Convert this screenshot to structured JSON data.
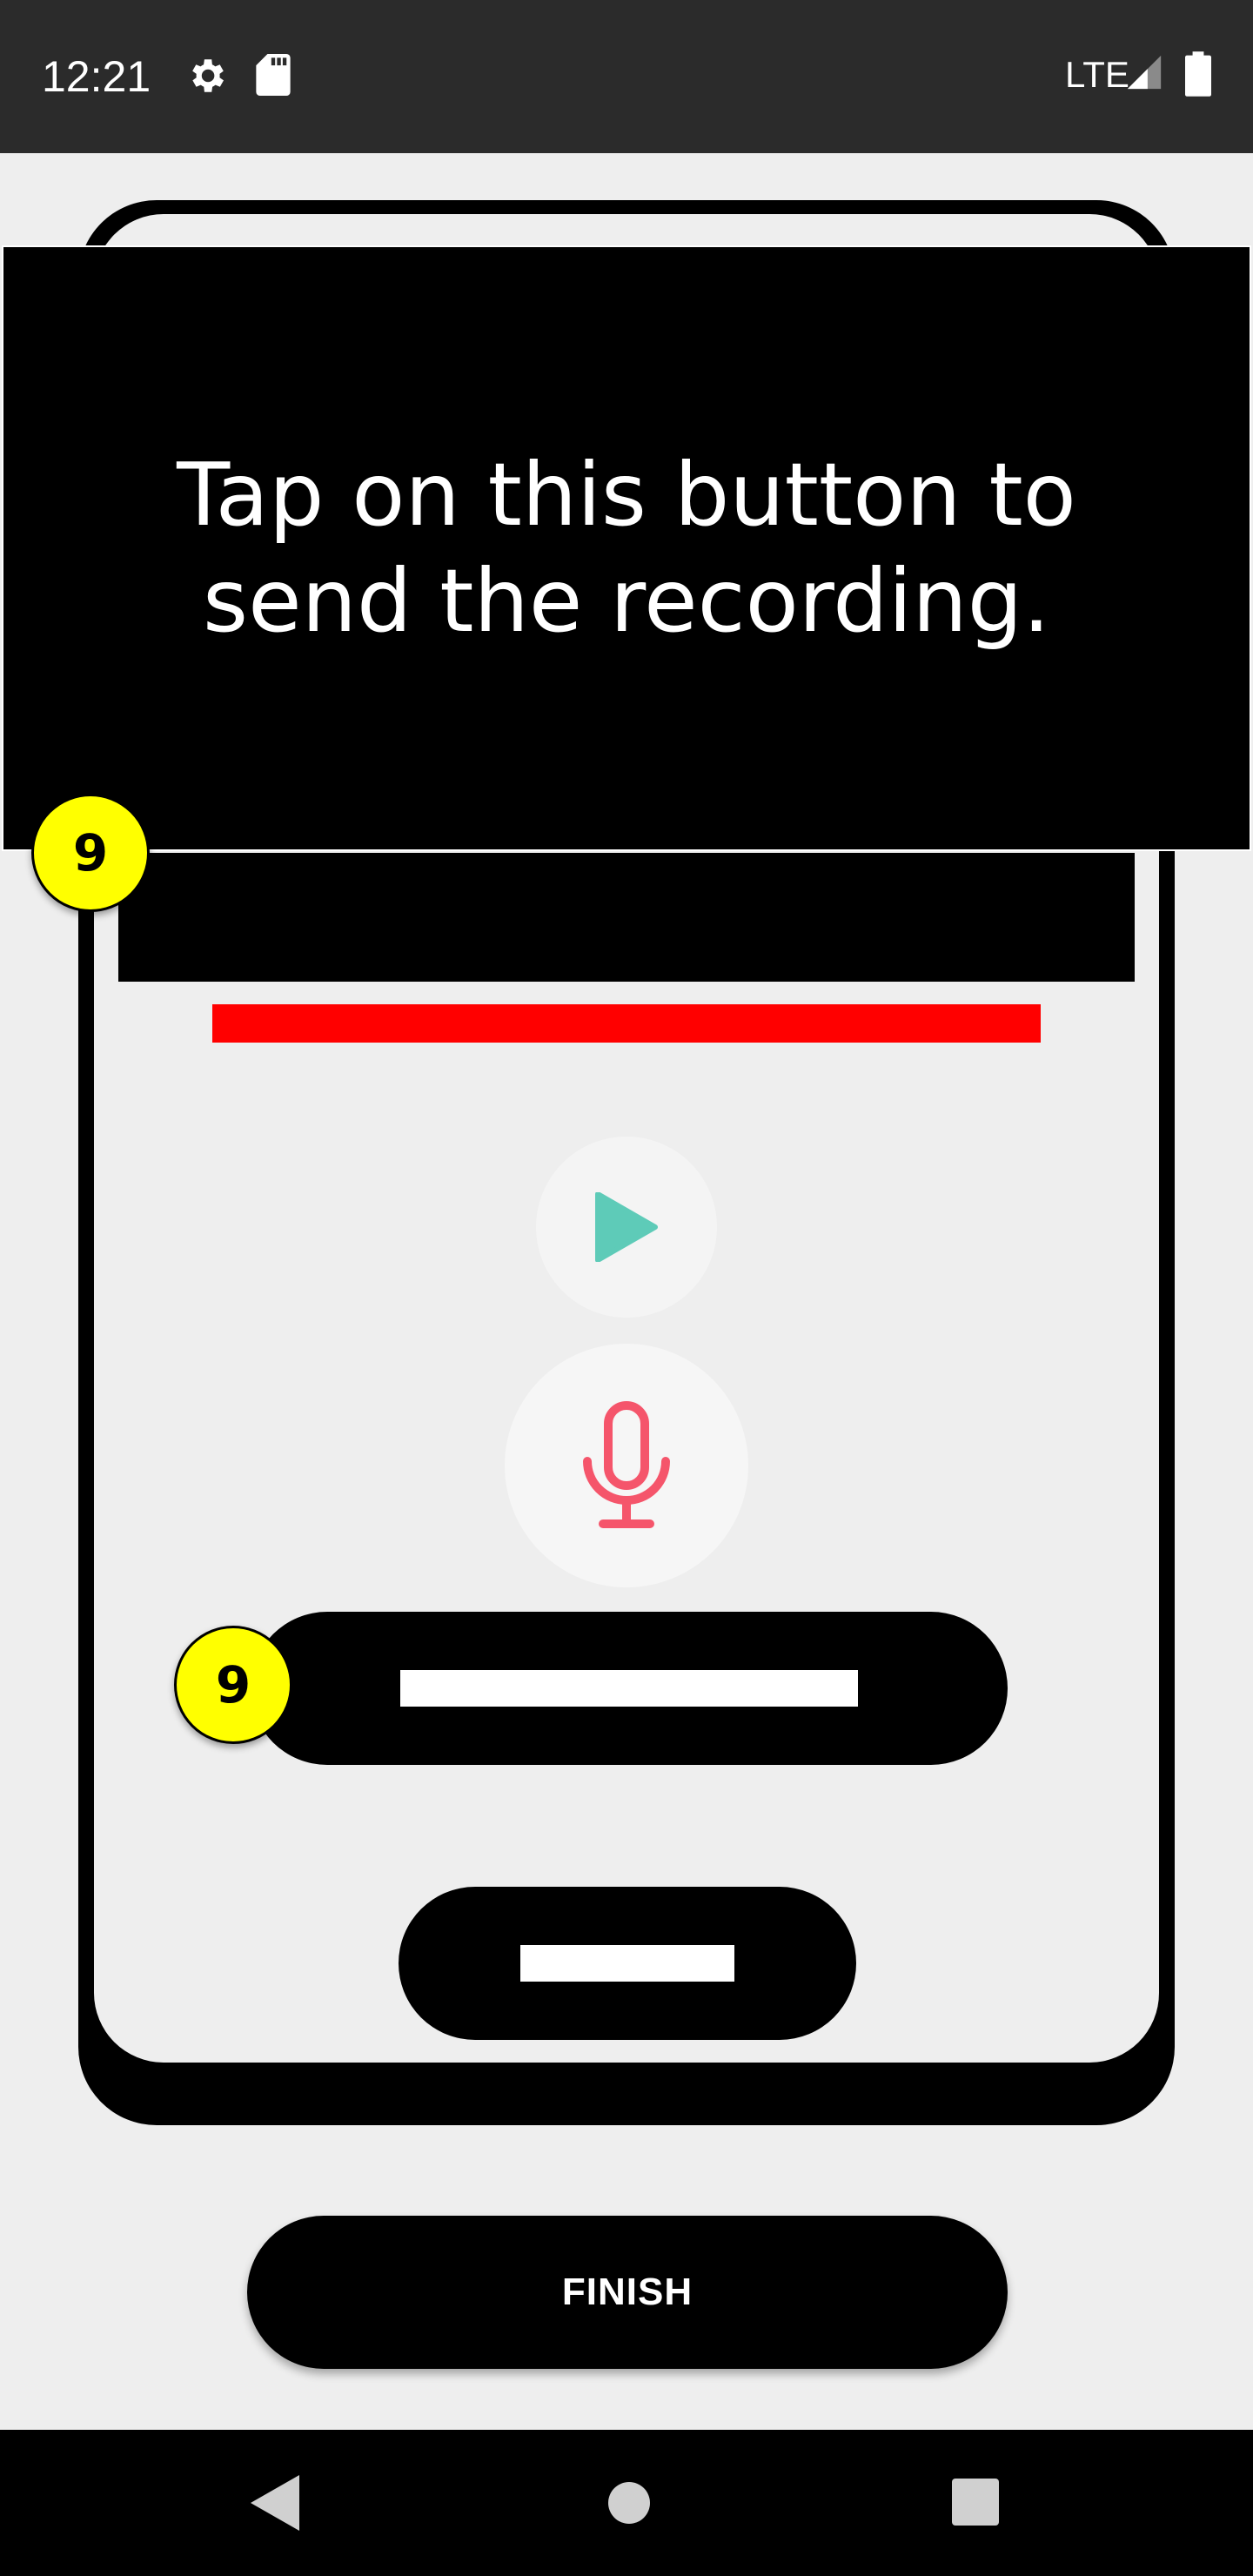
{
  "status_bar": {
    "time": "12:21",
    "network": "LTE",
    "icons": [
      "gear-icon",
      "sd-card-icon",
      "signal-icon",
      "battery-icon"
    ]
  },
  "tooltip": {
    "text": "Tap on this button to send the recording."
  },
  "badges": {
    "top": "9",
    "send": "9"
  },
  "controls": {
    "play_icon": "play-icon",
    "mic_icon": "microphone-icon"
  },
  "finish_label": "FINISH",
  "nav_bar": {
    "icons": [
      "back-icon",
      "home-icon",
      "recents-icon"
    ]
  },
  "colors": {
    "play": "#5ecbb8",
    "mic": "#f5556b",
    "highlight": "#ffff00",
    "progress": "#ff0000"
  }
}
